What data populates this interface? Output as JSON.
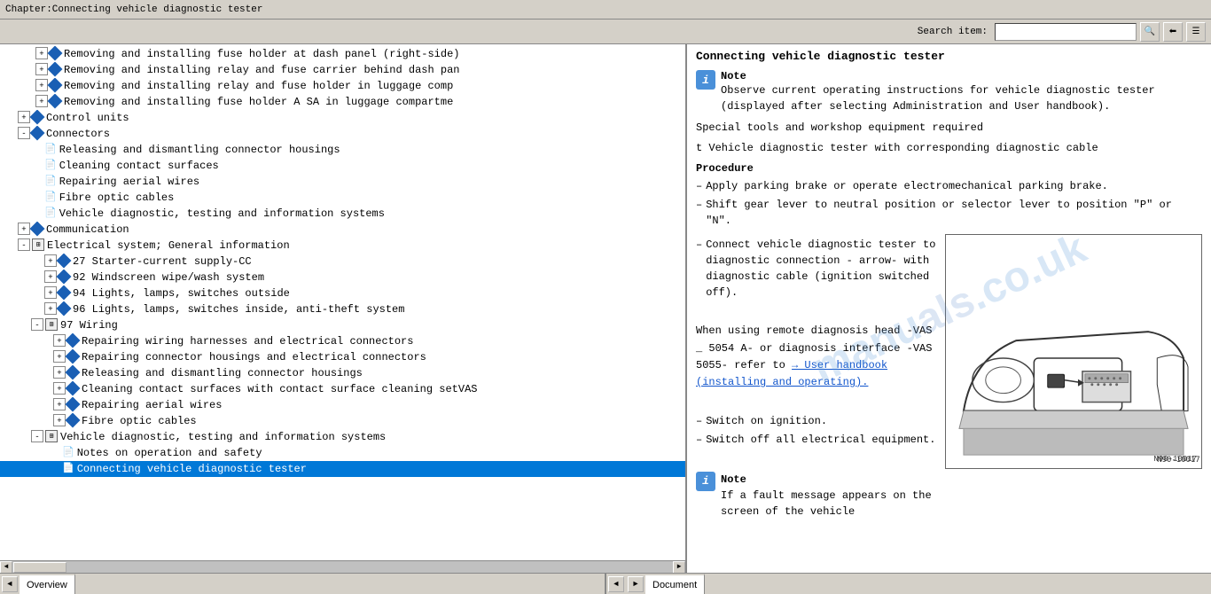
{
  "titleBar": {
    "text": "Chapter:Connecting vehicle diagnostic tester"
  },
  "toolbar": {
    "searchLabel": "Search item:",
    "searchPlaceholder": ""
  },
  "treeItems": [
    {
      "id": 1,
      "indent": 40,
      "type": "expand-doc",
      "text": "Removing and installing fuse holder at dash panel (right-side)",
      "expanded": false
    },
    {
      "id": 2,
      "indent": 40,
      "type": "expand-doc",
      "text": "Removing and installing relay and fuse carrier behind dash pan",
      "expanded": false
    },
    {
      "id": 3,
      "indent": 40,
      "type": "expand-doc",
      "text": "Removing and installing relay and fuse holder in luggage comp",
      "expanded": false
    },
    {
      "id": 4,
      "indent": 40,
      "type": "expand-doc",
      "text": "Removing and installing fuse holder A SA in luggage compartme",
      "expanded": false
    },
    {
      "id": 5,
      "indent": 20,
      "type": "expand-folder",
      "text": "Control units",
      "expanded": false
    },
    {
      "id": 6,
      "indent": 20,
      "type": "expand-folder",
      "text": "Connectors",
      "expanded": true
    },
    {
      "id": 7,
      "indent": 40,
      "type": "page",
      "text": "Releasing and dismantling connector housings"
    },
    {
      "id": 8,
      "indent": 40,
      "type": "page",
      "text": "Cleaning contact surfaces"
    },
    {
      "id": 9,
      "indent": 40,
      "type": "page",
      "text": "Repairing aerial wires"
    },
    {
      "id": 10,
      "indent": 40,
      "type": "page",
      "text": "Fibre optic cables"
    },
    {
      "id": 11,
      "indent": 40,
      "type": "page",
      "text": "Vehicle diagnostic, testing and information systems"
    },
    {
      "id": 12,
      "indent": 20,
      "type": "expand-folder",
      "text": "Communication",
      "expanded": false
    },
    {
      "id": 13,
      "indent": 20,
      "type": "expand-folder2",
      "text": "Electrical system; General information",
      "expanded": false
    },
    {
      "id": 14,
      "indent": 40,
      "type": "expand-doc",
      "text": "27 Starter-current supply-CC",
      "expanded": false
    },
    {
      "id": 15,
      "indent": 40,
      "type": "expand-doc",
      "text": "92 Windscreen wipe/wash system",
      "expanded": false
    },
    {
      "id": 16,
      "indent": 40,
      "type": "expand-doc",
      "text": "94 Lights, lamps, switches outside",
      "expanded": false
    },
    {
      "id": 17,
      "indent": 40,
      "type": "expand-doc",
      "text": "96 Lights, lamps, switches inside, anti-theft system",
      "expanded": false
    },
    {
      "id": 18,
      "indent": 30,
      "type": "expand-folder2",
      "text": "97 Wiring",
      "expanded": true
    },
    {
      "id": 19,
      "indent": 50,
      "type": "expand-doc",
      "text": "Repairing wiring harnesses and electrical connectors",
      "expanded": false
    },
    {
      "id": 20,
      "indent": 50,
      "type": "expand-doc",
      "text": "Repairing connector housings and electrical connectors",
      "expanded": false
    },
    {
      "id": 21,
      "indent": 50,
      "type": "expand-doc",
      "text": "Releasing and dismantling connector housings",
      "expanded": false
    },
    {
      "id": 22,
      "indent": 50,
      "type": "expand-doc",
      "text": "Cleaning contact surfaces with contact surface cleaning setVAS",
      "expanded": false
    },
    {
      "id": 23,
      "indent": 50,
      "type": "expand-doc",
      "text": "Repairing aerial wires",
      "expanded": false
    },
    {
      "id": 24,
      "indent": 50,
      "type": "expand-doc",
      "text": "Fibre optic cables",
      "expanded": false
    },
    {
      "id": 25,
      "indent": 30,
      "type": "expand-folder2",
      "text": "Vehicle diagnostic, testing and information systems",
      "expanded": true
    },
    {
      "id": 26,
      "indent": 60,
      "type": "page",
      "text": "Notes on operation and safety"
    },
    {
      "id": 27,
      "indent": 60,
      "type": "page-active",
      "text": "Connecting vehicle diagnostic tester"
    }
  ],
  "rightPanel": {
    "title": "Connecting vehicle diagnostic tester",
    "noteLabel": "Note",
    "noteText": "Observe current operating instructions for vehicle diagnostic tester (displayed after selecting Administration and User handbook).",
    "specialToolsText": "Special tools and workshop equipment required",
    "toolItem": "t  Vehicle diagnostic tester with corresponding diagnostic cable",
    "procedureHeading": "Procedure",
    "steps": [
      "Apply parking brake or operate electromechanical parking brake.",
      "Shift gear lever to neutral position or selector lever to position \"P\" or \"N\"."
    ],
    "connectText": "Connect vehicle diagnostic tester to diagnostic connection - arrow- with diagnostic cable (ignition switched off).",
    "remoteText": "When using remote diagnosis head -VAS _ 5054 A- or diagnosis interface -VAS 5055- refer to",
    "linkText": "→ User handbook (installing and operating).",
    "switchOn": "Switch on ignition.",
    "switchOff": "Switch off all electrical equipment.",
    "note2Label": "Note",
    "note2Text": "If a fault message appears on the screen of the vehicle",
    "imageLabel": "N90-10017",
    "arrowLabel": "arrow - With diagnostic"
  },
  "statusBar": {
    "leftTab": "Overview",
    "rightTab": "Document",
    "navLeft": "◄",
    "navRight": "►"
  }
}
